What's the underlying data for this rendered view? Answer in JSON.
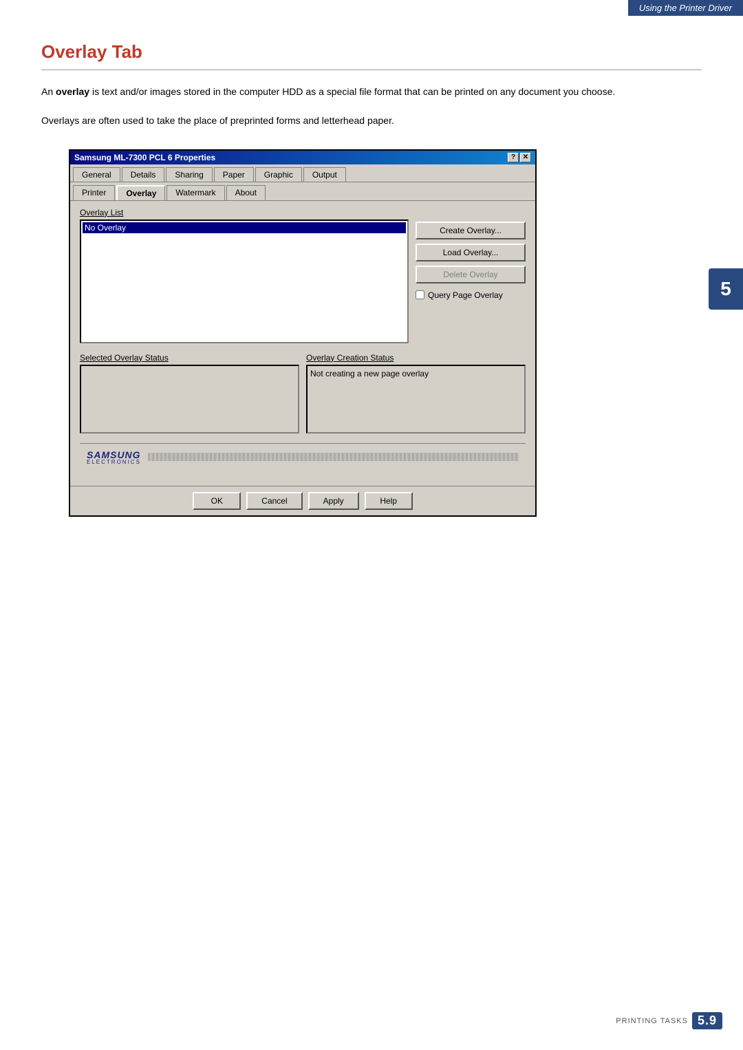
{
  "header": {
    "top_label": "Using the Printer Driver"
  },
  "side_tab": {
    "number": "5"
  },
  "page": {
    "title": "Overlay Tab",
    "intro1_plain": "An ",
    "intro1_bold": "overlay",
    "intro1_rest": " is text and/or images stored in the computer HDD as a special file format that can be printed on any document you choose.",
    "intro2": "Overlays are often used to take the place of preprinted forms and letterhead paper."
  },
  "dialog": {
    "title": "Samsung ML-7300 PCL 6 Properties",
    "help_icon": "?",
    "close_icon": "✕",
    "tabs": [
      {
        "label": "General",
        "active": false
      },
      {
        "label": "Details",
        "active": false
      },
      {
        "label": "Sharing",
        "active": false
      },
      {
        "label": "Paper",
        "active": false
      },
      {
        "label": "Graphic",
        "active": false
      },
      {
        "label": "Output",
        "active": false
      },
      {
        "label": "Printer",
        "active": false
      },
      {
        "label": "Overlay",
        "active": true
      },
      {
        "label": "Watermark",
        "active": false
      },
      {
        "label": "About",
        "active": false
      }
    ],
    "overlay_list_label": "Overlay List",
    "overlay_list_items": [
      "No Overlay"
    ],
    "buttons": {
      "create": "Create Overlay...",
      "load": "Load Overlay...",
      "delete": "Delete Overlay",
      "query_checkbox": "Query Page Overlay"
    },
    "selected_overlay_status_label": "Selected Overlay Status",
    "selected_overlay_status_value": "",
    "overlay_creation_status_label": "Overlay Creation Status",
    "overlay_creation_status_value": "Not creating a new page overlay",
    "samsung_logo": "SAMSUNG",
    "samsung_sub": "ELECTRONICS",
    "footer_buttons": {
      "ok": "OK",
      "cancel": "Cancel",
      "apply": "Apply",
      "help": "Help"
    }
  },
  "bottom_ref": {
    "text": "Printing Tasks",
    "number": "5.9"
  }
}
